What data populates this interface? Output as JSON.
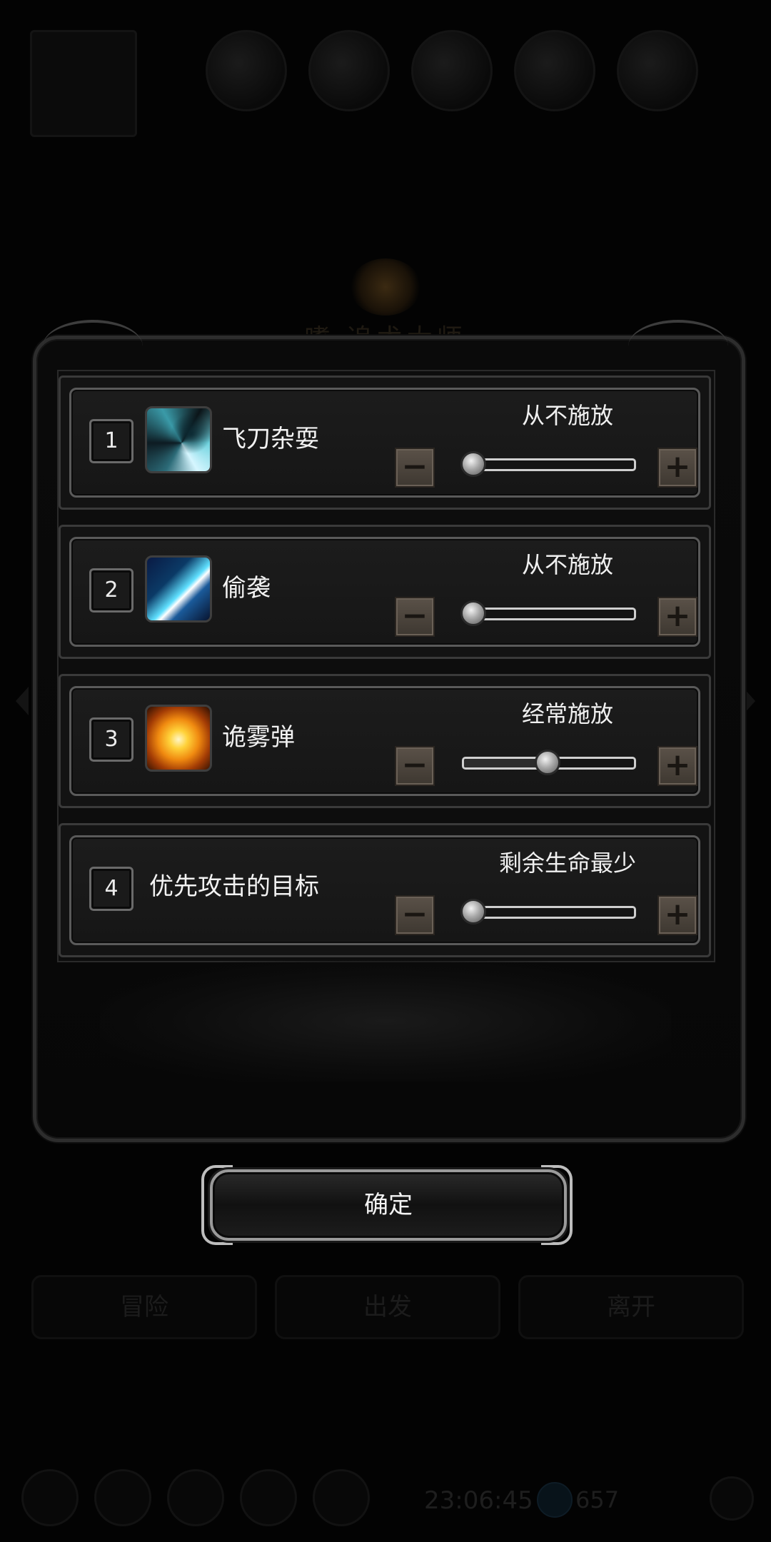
{
  "background": {
    "header_title": "嗜.追术大师",
    "bottom_buttons": [
      "冒险",
      "出发",
      "离开"
    ],
    "clock": "23:06:45",
    "gold": "657"
  },
  "skills": [
    {
      "number": "1",
      "name": "飞刀杂耍",
      "icon": "flying-knife-skill-icon",
      "level_label": "从不施放",
      "slider_value": 0.0
    },
    {
      "number": "2",
      "name": "偷袭",
      "icon": "sneak-attack-skill-icon",
      "level_label": "从不施放",
      "slider_value": 0.0
    },
    {
      "number": "3",
      "name": "诡雾弹",
      "icon": "smoke-bomb-skill-icon",
      "level_label": "经常施放",
      "slider_value": 0.5
    }
  ],
  "target_row": {
    "number": "4",
    "name": "优先攻击的目标",
    "level_label": "剩余生命最少",
    "slider_value": 0.0
  },
  "controls": {
    "minus_symbol": "−",
    "plus_symbol": "+"
  },
  "confirm_label": "确定",
  "colors": {
    "accent_brown": "#4a443c",
    "panel_border": "#5a5a5a",
    "background": "#030303"
  }
}
